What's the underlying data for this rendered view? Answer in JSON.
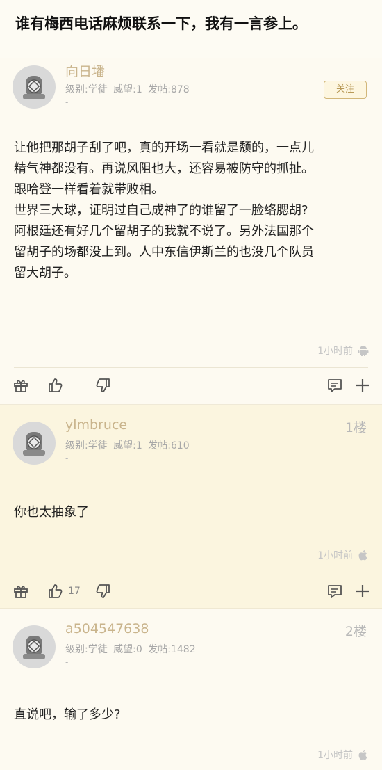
{
  "topic": {
    "title": "谁有梅西电话麻烦联系一下，我有一言参上。"
  },
  "op": {
    "username": "向日墦",
    "level_label": "级别:学徒",
    "prestige_label": "威望:1",
    "posts_label": "发帖:878",
    "dash": "-",
    "follow_label": "关注",
    "body_lines": [
      "让他把那胡子刮了吧，真的开场一看就是颓的，一点儿",
      "精气神都没有。再说风阻也大，还容易被防守的抓扯。",
      "跟哈登一样看着就带败相。",
      "世界三大球，证明过自己成神了的谁留了一脸络腮胡?",
      "阿根廷还有好几个留胡子的我就不说了。另外法国那个",
      "留胡子的场都没上到。人中东信伊斯兰的也没几个队员",
      "留大胡子。"
    ],
    "time": "1小时前",
    "device_icon": "android-icon"
  },
  "reply1": {
    "username": "ylmbruce",
    "level_label": "级别:学徒",
    "prestige_label": "威望:1",
    "posts_label": "发帖:610",
    "dash": "-",
    "floor": "1楼",
    "body": "你也太抽象了",
    "time": "1小时前",
    "device_icon": "apple-icon",
    "like_count": "17"
  },
  "reply2": {
    "username": "a504547638",
    "level_label": "级别:学徒",
    "prestige_label": "威望:0",
    "posts_label": "发帖:1482",
    "dash": "-",
    "floor": "2楼",
    "body": "直说吧，输了多少?",
    "time": "1小时前",
    "device_icon": "apple-icon"
  },
  "colors": {
    "username": "#c9b48c",
    "follow_border": "#d2b77a",
    "reply_highlight_bg": "#fbf5df"
  }
}
